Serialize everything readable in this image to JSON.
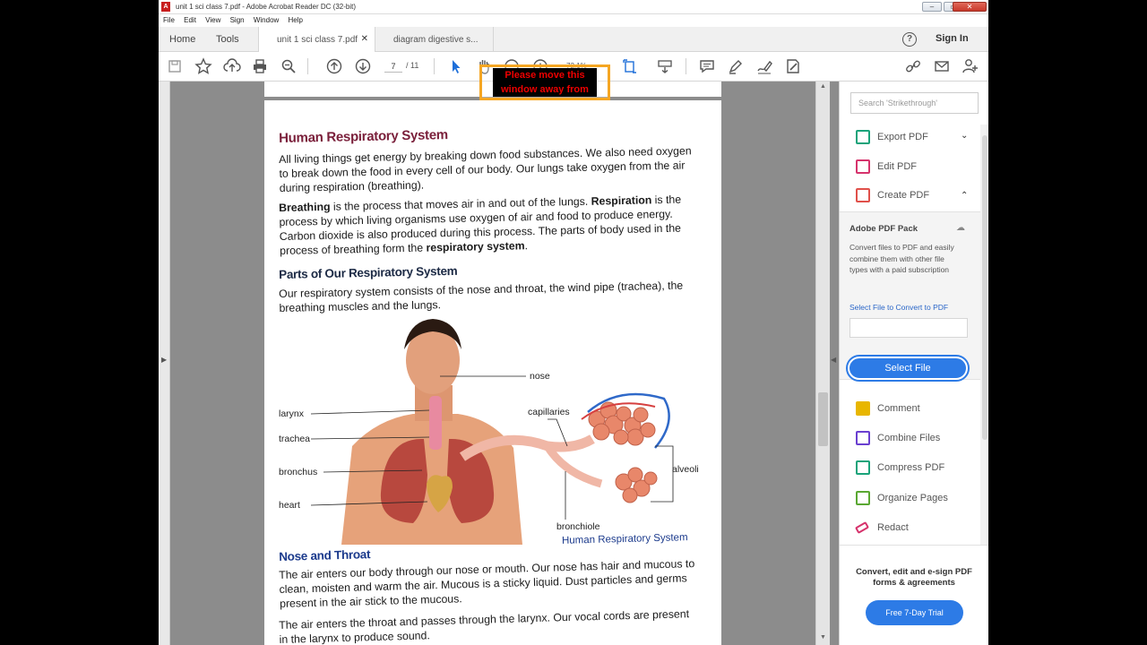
{
  "window": {
    "title": "unit 1 sci class 7.pdf - Adobe Acrobat Reader DC (32-bit)",
    "controls": [
      "–",
      "▭",
      "✕"
    ]
  },
  "menu": [
    "File",
    "Edit",
    "View",
    "Sign",
    "Window",
    "Help"
  ],
  "tabs": {
    "home": "Home",
    "tools": "Tools",
    "docs": [
      {
        "label": "unit 1 sci class 7.pdf",
        "active": true
      },
      {
        "label": "diagram digestive s...",
        "active": false
      }
    ],
    "help": "?",
    "signin": "Sign In"
  },
  "toolbar": {
    "page_current": "7",
    "page_total": "/ 11",
    "zoom": "72.1%"
  },
  "warning": {
    "line1": "Please move this",
    "line2": "window away from"
  },
  "document": {
    "section1_title": "Human Respiratory System",
    "para1": "All living things get energy by breaking down food substances. We also need oxygen to break down the food in every cell of our body. Our lungs take oxygen from the air during respiration (breathing).",
    "para2_b1": "Breathing",
    "para2_t1": " is the process that moves air in and out of the lungs. ",
    "para2_b2": "Respiration",
    "para2_t2": " is the process by which living organisms use oxygen of air and food to produce energy. Carbon dioxide is also produced during this process. The parts of body used in the process of breathing form the ",
    "para2_b3": "respiratory system",
    "para2_t3": ".",
    "section2_title": "Parts of Our Respiratory System",
    "para3": "Our respiratory system consists of the nose and throat, the wind pipe (trachea), the breathing muscles and the lungs.",
    "diagram": {
      "labels": {
        "nose": "nose",
        "larynx": "larynx",
        "trachea": "trachea",
        "bronchus": "bronchus",
        "heart": "heart",
        "capillaries": "capillaries",
        "alveoli": "alveoli",
        "bronchiole": "bronchiole"
      },
      "caption": "Human Respiratory System"
    },
    "section3_title": "Nose and Throat",
    "para4": "The air enters our body through our nose or mouth. Our nose has hair and mucous to clean, moisten and warm the air. Mucous is a sticky liquid. Dust particles and germs present in the air stick to the mucous.",
    "para5": "The air enters the throat and passes through the larynx. Our vocal cords are present in the larynx to produce sound."
  },
  "right_panel": {
    "search_placeholder": "Search 'Strikethrough'",
    "tools_top": [
      {
        "label": "Export PDF",
        "chevron": "⌄",
        "color": "#1aa37a"
      },
      {
        "label": "Edit PDF",
        "chevron": "",
        "color": "#d6336c"
      },
      {
        "label": "Create PDF",
        "chevron": "⌃",
        "color": "#e0504a"
      }
    ],
    "pack": {
      "title": "Adobe PDF Pack",
      "description": "Convert files to PDF and easily combine them with other file types with a paid subscription",
      "link": "Select File to Convert to PDF",
      "button": "Select File"
    },
    "tools_bottom": [
      {
        "label": "Comment",
        "color": "#e8b600"
      },
      {
        "label": "Combine Files",
        "color": "#6a3fd0"
      },
      {
        "label": "Compress PDF",
        "color": "#1aa37a"
      },
      {
        "label": "Organize Pages",
        "color": "#5aa832"
      },
      {
        "label": "Redact",
        "color": "#d6336c"
      }
    ],
    "footer_text": "Convert, edit and e-sign PDF forms & agreements",
    "footer_button": "Free 7-Day Trial"
  }
}
